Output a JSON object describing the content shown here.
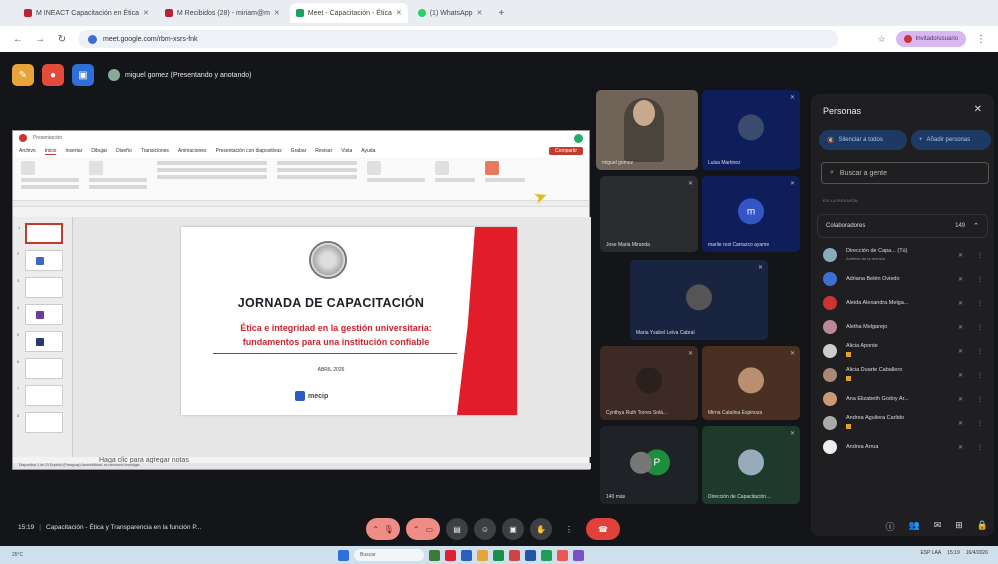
{
  "browser": {
    "tabs": [
      {
        "label": "M INEACT Capacitación en Ética"
      },
      {
        "label": "M Recibidos (28) - miriam@m"
      },
      {
        "label": "Meet - Capacitación - Ética"
      },
      {
        "label": "(1) WhatsApp"
      }
    ],
    "new_tab": "+",
    "url": "meet.google.com/rbm-xsrs-fnk",
    "profile": "Invitado/usuario"
  },
  "meet": {
    "presenter_label": "miguel gomez (Presentando y anotando)",
    "shared": {
      "top_text": "Presentación",
      "menu_items": [
        "Archivo",
        "Inicio",
        "Insertar",
        "Dibujar",
        "Diseño",
        "Transiciones",
        "Animaciones",
        "Presentación con diapositivas",
        "Grabar",
        "Revisar",
        "Vista",
        "Ayuda"
      ],
      "share_label": "Compartir",
      "slide": {
        "title": "JORNADA DE CAPACITACIÓN",
        "subtitle_line1": "Ética e integridad en la gestión universitaria:",
        "subtitle_line2": "fundamentos para una institución confiable",
        "date": "ABRIL 2026",
        "logo_text": "mecip"
      },
      "notes": "Haga clic para agregar notas",
      "status": "Diapositiva 1 de 23   Español (Paraguay)   Accesibilidad: es necesario investigar",
      "thumb_numbers": [
        "1",
        "2",
        "3",
        "4",
        "5",
        "6",
        "7",
        "8",
        "9"
      ]
    },
    "tiles": [
      {
        "name": "miguel gomez"
      },
      {
        "name": "Luisa Martinez"
      },
      {
        "name": "Jose Maria Miranda"
      },
      {
        "name": "marlie rosi Carrazco ayame",
        "initial": "m"
      },
      {
        "name": "Maria Ysabel Leiva Cabral"
      },
      {
        "name": "Cynthya Ruth Torres Solá..."
      },
      {
        "name": "Mirna Catalina Espinoza"
      },
      {
        "name": "140 más",
        "initial": "P"
      },
      {
        "name": "Dirección de Capacitación..."
      }
    ],
    "people": {
      "title": "Personas",
      "mute_all": "Silenciar a todos",
      "add_people": "Añadir personas",
      "search_placeholder": "Buscar a gente",
      "group_label": "EN LA REUNIÓN",
      "collaborators": "Colaboradores",
      "count": "149",
      "list": [
        {
          "name": "Dirección de Capa... (Tú)",
          "sub": "Anfitrión de la reunión"
        },
        {
          "name": "Adriana Belén Oviedo"
        },
        {
          "name": "Aleida Alexandra Melga..."
        },
        {
          "name": "Aletha Melgarejo"
        },
        {
          "name": "Alicia Aponte"
        },
        {
          "name": "Alicia Duarte Caballero"
        },
        {
          "name": "Ana Elizabeth Godoy Ar..."
        },
        {
          "name": "Andrea Aguilera Carlido"
        },
        {
          "name": "Andrea Arrua"
        }
      ]
    },
    "bottom": {
      "time": "15:19",
      "meeting_name": "Capacitación - Ética y Transparencia en la función P...",
      "badge": "149"
    }
  },
  "taskbar": {
    "weather": "25°C",
    "search": "Buscar",
    "lang": "ESP LAA",
    "clock": "15:19",
    "date": "16/4/2026"
  },
  "colors": {
    "accent_red": "#e11d2a",
    "end_call": "#e0413a",
    "panel_button": "#1d3a62"
  }
}
